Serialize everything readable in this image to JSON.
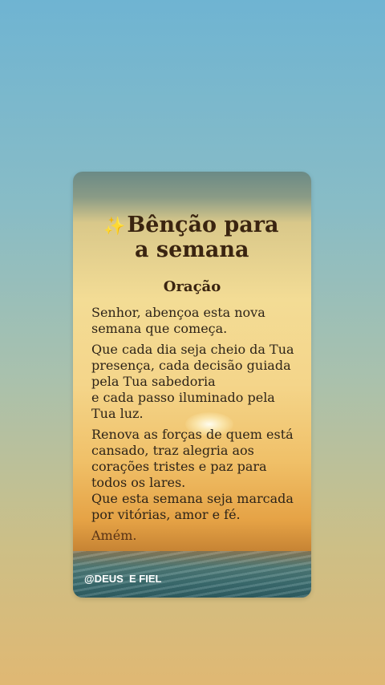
{
  "title": {
    "sparkle": "✨",
    "line1": "Bênção para",
    "line2": "a semana"
  },
  "subtitle": "Oração",
  "paragraphs": [
    "Senhor, abençoa esta nova semana que começa.",
    "Que cada dia seja cheio da Tua presença, cada decisão guiada pela Tua sabedoria",
    "e cada passo iluminado pela Tua luz.",
    "Renova as forças de quem está cansado, traz alegria aos corações tristes e paz para todos os lares.",
    "Que esta semana seja marcada por vitórias, amor e fé."
  ],
  "closing": "Amém.",
  "handle": "@DEUS  E FIEL",
  "colors": {
    "title_text": "#3a2410",
    "body_text": "#2e2418",
    "sparkle": "#f2c23a"
  }
}
